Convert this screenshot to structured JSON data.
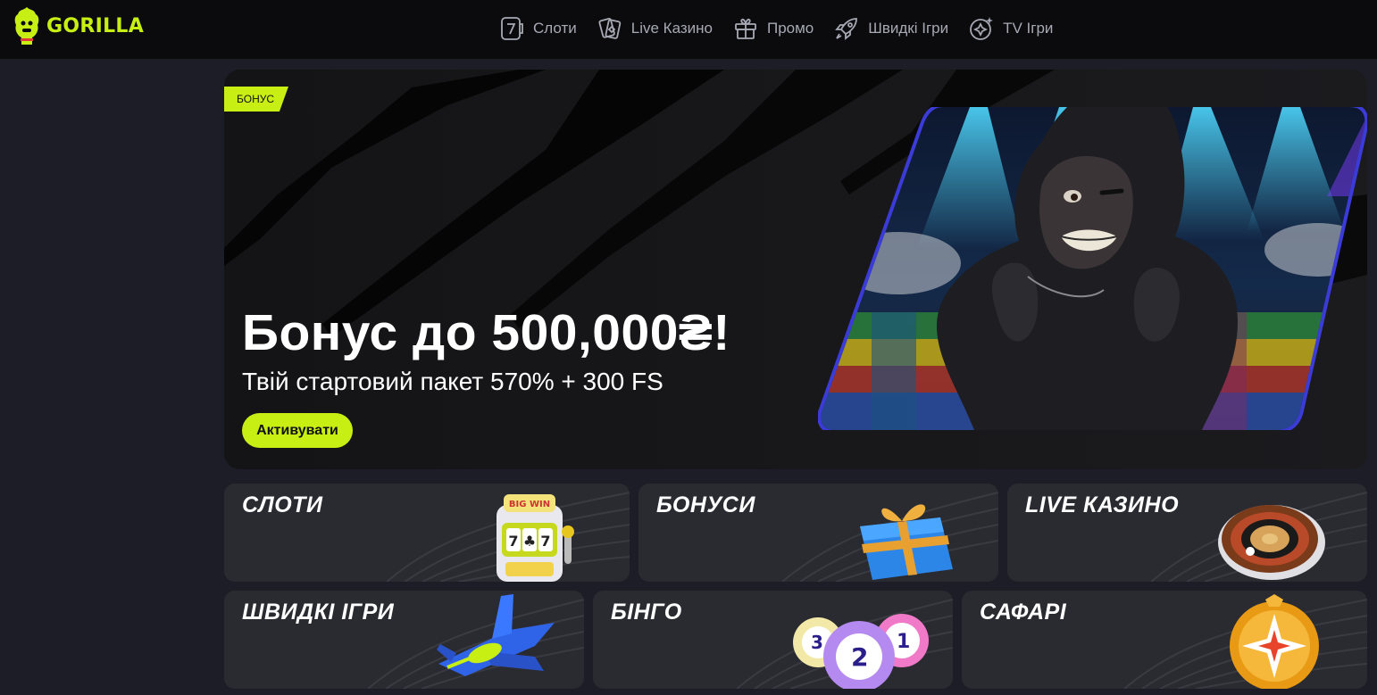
{
  "brand": {
    "name": "GORILLA",
    "accent": "#c7ef14"
  },
  "nav": [
    {
      "label": "Слоти",
      "icon": "slot-seven-icon"
    },
    {
      "label": "Live Казино",
      "icon": "cards-icon"
    },
    {
      "label": "Промо",
      "icon": "gift-icon"
    },
    {
      "label": "Швидкі Ігри",
      "icon": "rocket-icon"
    },
    {
      "label": "TV Ігри",
      "icon": "sparkle-icon"
    }
  ],
  "hero": {
    "tag": "БОНУС",
    "title": "Бонус до 500,000₴!",
    "subtitle": "Твій стартовий пакет 570% + 300 FS",
    "cta": "Активувати"
  },
  "categories": [
    {
      "title": "СЛОТИ",
      "image": "slot-machine-icon"
    },
    {
      "title": "БОНУСИ",
      "image": "gift-box-icon"
    },
    {
      "title": "LIVE КАЗИНО",
      "image": "roulette-icon"
    },
    {
      "title": "ШВИДКІ ІГРИ",
      "image": "jet-icon"
    },
    {
      "title": "БІНГО",
      "image": "bingo-balls-icon"
    },
    {
      "title": "САФАРІ",
      "image": "safari-coin-icon"
    }
  ],
  "bingo_numbers": [
    "3",
    "2",
    "1"
  ],
  "slot_reels": [
    "7",
    "♣",
    "7"
  ],
  "slot_sign": "BIG WIN"
}
